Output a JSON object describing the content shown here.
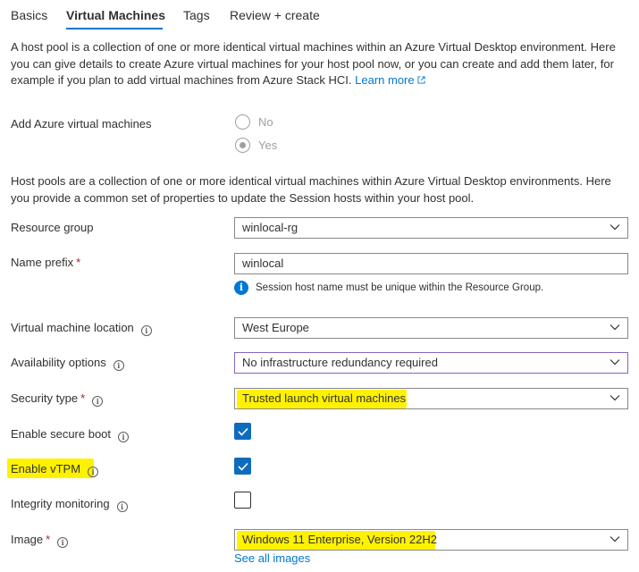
{
  "tabs": [
    "Basics",
    "Virtual Machines",
    "Tags",
    "Review + create"
  ],
  "active_tab": "Virtual Machines",
  "intro": {
    "text": "A host pool is a collection of one or more identical virtual machines within an Azure Virtual Desktop environment. Here you can give details to create Azure virtual machines for your host pool now, or you can create and add them later, for example if you plan to add virtual machines from Azure Stack HCI.",
    "link": "Learn more"
  },
  "add_vms": {
    "label": "Add Azure virtual machines",
    "options": [
      "No",
      "Yes"
    ],
    "selected": "Yes"
  },
  "host_pool_para": "Host pools are a collection of one or more identical virtual machines within Azure Virtual Desktop environments. Here you provide a common set of properties to update the Session hosts within your host pool.",
  "fields": {
    "resource_group": {
      "label": "Resource group",
      "value": "winlocal-rg"
    },
    "name_prefix": {
      "label": "Name prefix",
      "required": "*",
      "value": "winlocal",
      "hint": "Session host name must be unique within the Resource Group."
    },
    "vm_location": {
      "label": "Virtual machine location",
      "value": "West Europe"
    },
    "availability": {
      "label": "Availability options",
      "value": "No infrastructure redundancy required"
    },
    "security_type": {
      "label": "Security type",
      "required": "*",
      "value": "Trusted launch virtual machines"
    },
    "secure_boot": {
      "label": "Enable secure boot",
      "checked": true
    },
    "vtpm": {
      "label": "Enable vTPM",
      "checked": true
    },
    "integrity": {
      "label": "Integrity monitoring",
      "checked": false
    },
    "image": {
      "label": "Image",
      "required": "*",
      "value": "Windows 11 Enterprise, Version 22H2",
      "link": "See all images"
    }
  },
  "colors": {
    "accent": "#0078d4",
    "highlight": "#fff200",
    "checkbox": "#0f6cbd",
    "required": "#a4262c"
  }
}
